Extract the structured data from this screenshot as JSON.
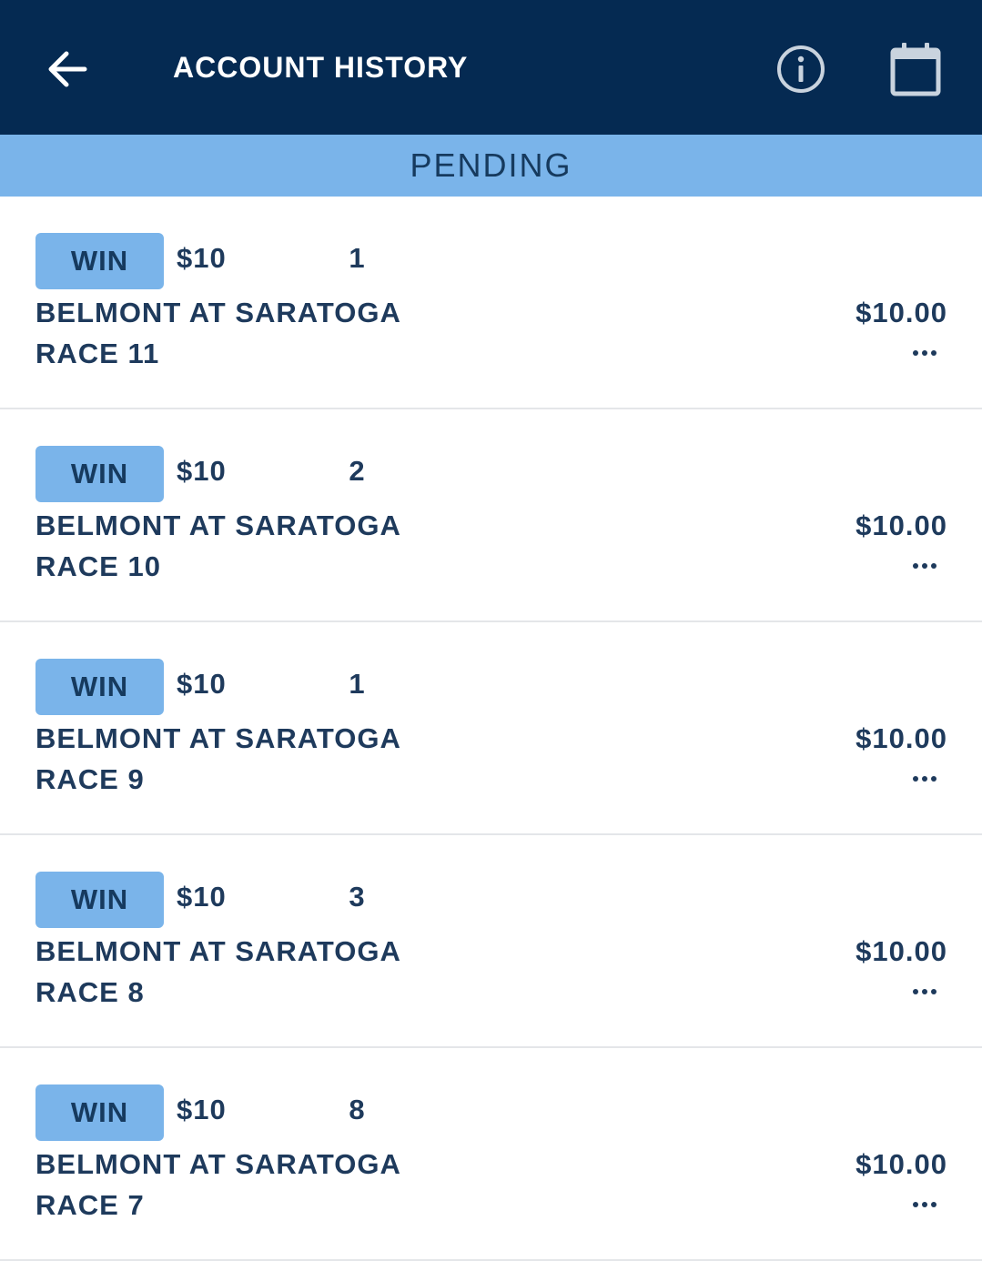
{
  "header": {
    "title": "ACCOUNT HISTORY",
    "back_icon": "arrow-left-icon",
    "info_icon": "info-circle-icon",
    "calendar_icon": "calendar-icon",
    "background_color": "#052a52"
  },
  "section": {
    "label": "PENDING",
    "background_color": "#7ab4ea"
  },
  "wagers": [
    {
      "type": "WIN",
      "amount": "$10",
      "selection": "1",
      "track": "BELMONT AT SARATOGA",
      "race": "RACE 11",
      "total": "$10.00"
    },
    {
      "type": "WIN",
      "amount": "$10",
      "selection": "2",
      "track": "BELMONT AT SARATOGA",
      "race": "RACE 10",
      "total": "$10.00"
    },
    {
      "type": "WIN",
      "amount": "$10",
      "selection": "1",
      "track": "BELMONT AT SARATOGA",
      "race": "RACE 9",
      "total": "$10.00"
    },
    {
      "type": "WIN",
      "amount": "$10",
      "selection": "3",
      "track": "BELMONT AT SARATOGA",
      "race": "RACE 8",
      "total": "$10.00"
    },
    {
      "type": "WIN",
      "amount": "$10",
      "selection": "8",
      "track": "BELMONT AT SARATOGA",
      "race": "RACE 7",
      "total": "$10.00"
    }
  ]
}
